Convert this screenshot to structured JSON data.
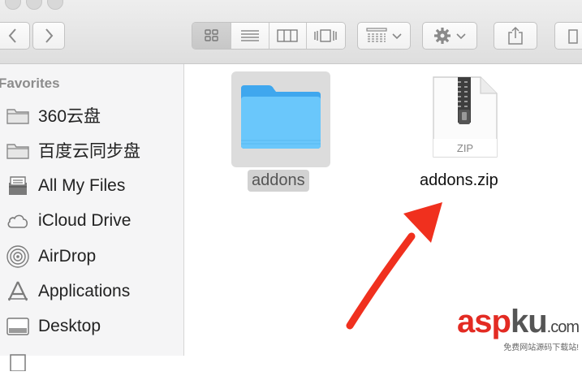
{
  "window": {
    "traffic_lights": [
      "close",
      "minimize",
      "zoom"
    ]
  },
  "toolbar": {
    "back_icon": "chevron-left-icon",
    "forward_icon": "chevron-right-icon",
    "view_modes": [
      "icon-view",
      "list-view",
      "column-view",
      "cover-flow-view"
    ],
    "active_view": "icon-view",
    "arrange_icon": "arrange-icon",
    "action_icon": "gear-icon",
    "share_icon": "share-icon"
  },
  "sidebar": {
    "header": "Favorites",
    "items": [
      {
        "label": "360云盘",
        "icon": "folder-icon"
      },
      {
        "label": "百度云同步盘",
        "icon": "folder-icon"
      },
      {
        "label": "All My Files",
        "icon": "all-files-icon"
      },
      {
        "label": "iCloud Drive",
        "icon": "cloud-icon"
      },
      {
        "label": "AirDrop",
        "icon": "airdrop-icon"
      },
      {
        "label": "Applications",
        "icon": "applications-icon"
      },
      {
        "label": "Desktop",
        "icon": "desktop-icon"
      }
    ]
  },
  "files": [
    {
      "name": "addons",
      "type": "folder",
      "selected": true
    },
    {
      "name": "addons.zip",
      "type": "zip",
      "badge": "ZIP",
      "selected": false
    }
  ],
  "annotation": {
    "type": "red-arrow",
    "target": "addons.zip"
  },
  "watermark": {
    "brand_asp": "asp",
    "brand_ku": "ku",
    "brand_com": ".com",
    "tagline": "免费网站源码下载站!"
  },
  "colors": {
    "folder_blue": "#5cbcf5",
    "arrow_red": "#f0301e",
    "selection_grey": "#dcdcdc",
    "watermark_red": "#e32b23"
  }
}
